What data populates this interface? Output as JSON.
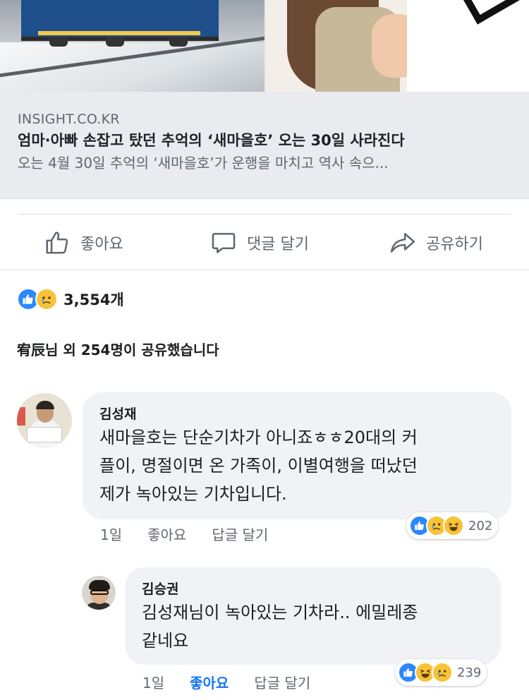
{
  "link_card": {
    "domain": "INSIGHT.CO.KR",
    "title": "엄마·아빠 손잡고 탔던 추억의 ‘새마을호’ 오는 30일 사라진다",
    "description": "오는 4월 30일 추억의 ‘새마을호’가 운행을 마치고 역사 속으..."
  },
  "actions": {
    "like": "좋아요",
    "comment": "댓글 달기",
    "share": "공유하기"
  },
  "post_reactions": {
    "count": "3,554개",
    "types": [
      "like-icon",
      "sad-icon"
    ]
  },
  "shared_text": "宥辰님 외 254명이 공유했습니다",
  "comments": [
    {
      "author": "김성재",
      "lines": [
        "새마을호는 단순기차가 아니죠ㅎㅎ20대의 커",
        "플이, 명절이면 온 가족이, 이별여행을 떠났던",
        "제가 녹아있는 기차입니다."
      ],
      "time": "1일",
      "like": "좋아요",
      "reply": "답글 달기",
      "reactions": [
        "like-icon",
        "sad-icon",
        "haha-icon"
      ],
      "reaction_count": "202"
    },
    {
      "author": "김승권",
      "lines": [
        "김성재님이 녹아있는 기차라.. 에밀레종",
        "같네요"
      ],
      "time": "1일",
      "like": "좋아요",
      "reply": "답글 달기",
      "reactions": [
        "like-icon",
        "haha-icon",
        "sad-icon"
      ],
      "reaction_count": "239"
    }
  ],
  "colors": {
    "accent": "#1877f2",
    "like_blue": "#2d88ff",
    "emoji_yellow": "#f7c33a",
    "bubble_bg": "#f0f2f5",
    "card_bg": "#e9ebee",
    "muted_text": "#606770"
  }
}
